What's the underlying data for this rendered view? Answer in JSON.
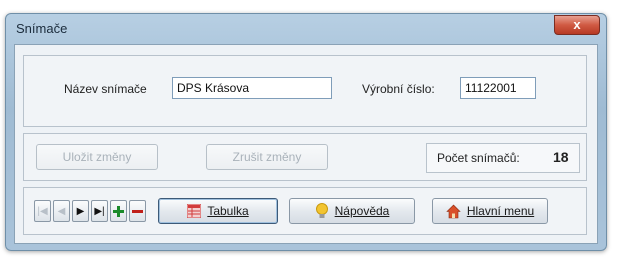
{
  "window": {
    "title": "Snímače",
    "close_symbol": "x"
  },
  "form": {
    "name_label": "Název snímače",
    "name_value": "DPS Krásova",
    "serial_label": "Výrobní číslo:",
    "serial_value": "11122001"
  },
  "actions": {
    "save_label": "Uložit změny",
    "cancel_label": "Zrušit změny",
    "count_label": "Počet snímačů:",
    "count_value": "18"
  },
  "toolbar": {
    "table_label": "Tabulka",
    "help_label": "Nápověda",
    "main_menu_label": "Hlavní menu"
  },
  "colors": {
    "add": "#1a8a2a",
    "delete": "#c0201a",
    "table_icon": "#d23c3c",
    "help_icon": "#f2c430",
    "home_icon": "#d9502a"
  }
}
